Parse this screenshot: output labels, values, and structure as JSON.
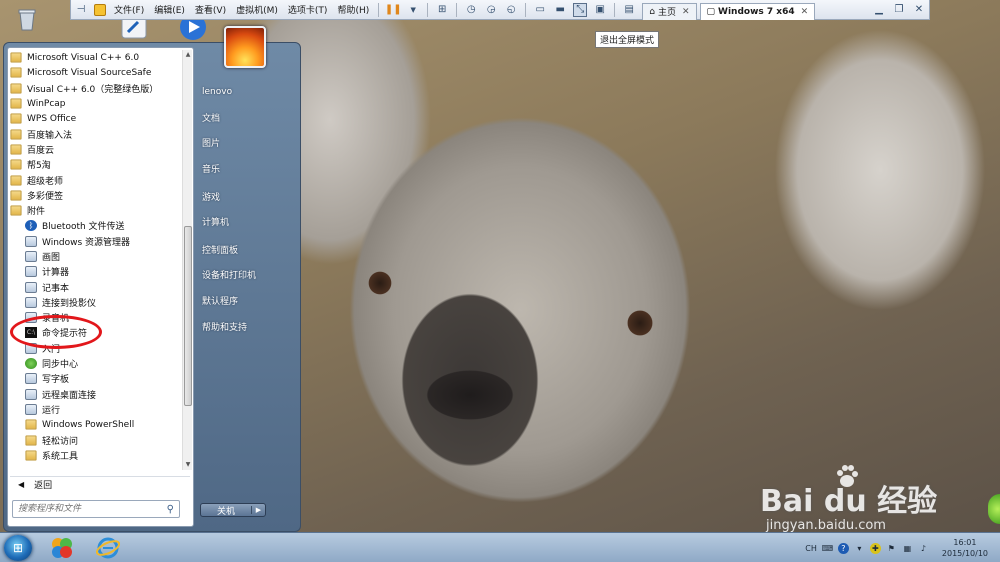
{
  "vm_toolbar": {
    "menus": [
      "文件(F)",
      "编辑(E)",
      "查看(V)",
      "虚拟机(M)",
      "选项卡(T)",
      "帮助(H)"
    ],
    "tabs": [
      {
        "label": "主页",
        "active": false
      },
      {
        "label": "Windows 7 x64",
        "active": true
      }
    ],
    "tooltip": "退出全屏模式"
  },
  "start_menu": {
    "programs": [
      {
        "label": "Microsoft Visual C++ 6.0",
        "icon": "folder-icon",
        "indent": false
      },
      {
        "label": "Microsoft Visual SourceSafe",
        "icon": "folder-icon",
        "indent": false
      },
      {
        "label": "Visual C++ 6.0（完整绿色版）",
        "icon": "folder-icon",
        "indent": false
      },
      {
        "label": "WinPcap",
        "icon": "folder-icon",
        "indent": false
      },
      {
        "label": "WPS Office",
        "icon": "folder-icon",
        "indent": false
      },
      {
        "label": "百度输入法",
        "icon": "folder-icon",
        "indent": false
      },
      {
        "label": "百度云",
        "icon": "folder-icon",
        "indent": false
      },
      {
        "label": "帮5淘",
        "icon": "folder-icon",
        "indent": false
      },
      {
        "label": "超级老师",
        "icon": "folder-icon",
        "indent": false
      },
      {
        "label": "多彩便签",
        "icon": "folder-icon",
        "indent": false
      },
      {
        "label": "附件",
        "icon": "folder-icon",
        "indent": false
      },
      {
        "label": "Bluetooth 文件传送",
        "icon": "bluetooth-icon",
        "indent": true
      },
      {
        "label": "Windows 资源管理器",
        "icon": "explorer-icon",
        "indent": true
      },
      {
        "label": "画图",
        "icon": "paint-icon",
        "indent": true
      },
      {
        "label": "计算器",
        "icon": "calculator-icon",
        "indent": true
      },
      {
        "label": "记事本",
        "icon": "notepad-icon",
        "indent": true
      },
      {
        "label": "连接到投影仪",
        "icon": "projector-icon",
        "indent": true
      },
      {
        "label": "录音机",
        "icon": "recorder-icon",
        "indent": true
      },
      {
        "label": "命令提示符",
        "icon": "cmd-icon",
        "indent": true
      },
      {
        "label": "入门",
        "icon": "getting-started-icon",
        "indent": true
      },
      {
        "label": "同步中心",
        "icon": "sync-center-icon",
        "indent": true
      },
      {
        "label": "写字板",
        "icon": "wordpad-icon",
        "indent": true
      },
      {
        "label": "远程桌面连接",
        "icon": "remote-desktop-icon",
        "indent": true
      },
      {
        "label": "运行",
        "icon": "run-icon",
        "indent": true
      },
      {
        "label": "Windows PowerShell",
        "icon": "folder-icon",
        "indent": true
      },
      {
        "label": "轻松访问",
        "icon": "folder-icon",
        "indent": true
      },
      {
        "label": "系统工具",
        "icon": "folder-icon",
        "indent": true
      }
    ],
    "back_label": "返回",
    "search_placeholder": "搜索程序和文件",
    "right_items": [
      {
        "label": "lenovo",
        "gap_after": false
      },
      {
        "label": "文档",
        "gap_after": false
      },
      {
        "label": "图片",
        "gap_after": false
      },
      {
        "label": "音乐",
        "gap_after": true
      },
      {
        "label": "游戏",
        "gap_after": false
      },
      {
        "label": "计算机",
        "gap_after": true
      },
      {
        "label": "控制面板",
        "gap_after": false
      },
      {
        "label": "设备和打印机",
        "gap_after": false
      },
      {
        "label": "默认程序",
        "gap_after": false
      },
      {
        "label": "帮助和支持",
        "gap_after": false
      }
    ],
    "shutdown_label": "关机"
  },
  "taskbar": {
    "lang": "CH",
    "time": "16:01",
    "date": "2015/10/10"
  },
  "watermark": {
    "brand": "Bai  du 经验",
    "url": "jingyan.baidu.com"
  },
  "colors": {
    "annotation": "#e2171b",
    "menu_right_pane": "#4f6885"
  }
}
